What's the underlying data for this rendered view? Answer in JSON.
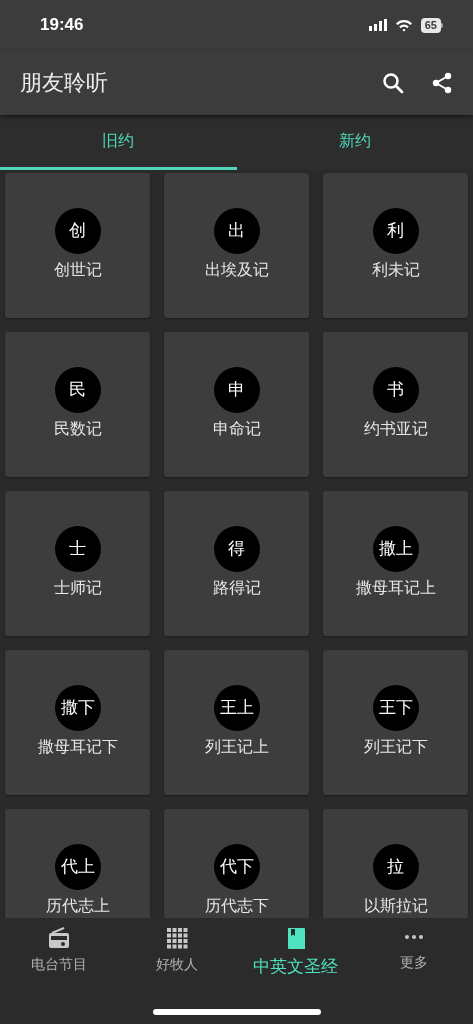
{
  "status_bar": {
    "time": "19:46",
    "battery": "65"
  },
  "app_bar": {
    "title": "朋友聆听"
  },
  "tabs": [
    {
      "label": "旧约",
      "selected": true
    },
    {
      "label": "新约",
      "selected": false
    }
  ],
  "books": [
    {
      "badge": "创",
      "name": "创世记"
    },
    {
      "badge": "出",
      "name": "出埃及记"
    },
    {
      "badge": "利",
      "name": "利未记"
    },
    {
      "badge": "民",
      "name": "民数记"
    },
    {
      "badge": "申",
      "name": "申命记"
    },
    {
      "badge": "书",
      "name": "约书亚记"
    },
    {
      "badge": "士",
      "name": "士师记"
    },
    {
      "badge": "得",
      "name": "路得记"
    },
    {
      "badge": "撒上",
      "name": "撒母耳记上"
    },
    {
      "badge": "撒下",
      "name": "撒母耳记下"
    },
    {
      "badge": "王上",
      "name": "列王记上"
    },
    {
      "badge": "王下",
      "name": "列王记下"
    },
    {
      "badge": "代上",
      "name": "历代志上"
    },
    {
      "badge": "代下",
      "name": "历代志下"
    },
    {
      "badge": "拉",
      "name": "以斯拉记"
    }
  ],
  "bottom_nav": [
    {
      "kind": "radio",
      "label": "电台节目",
      "selected": false
    },
    {
      "kind": "grid",
      "label": "好牧人",
      "selected": false
    },
    {
      "kind": "book",
      "label": "中英文圣经",
      "selected": true
    },
    {
      "kind": "more",
      "label": "更多",
      "selected": false
    }
  ]
}
